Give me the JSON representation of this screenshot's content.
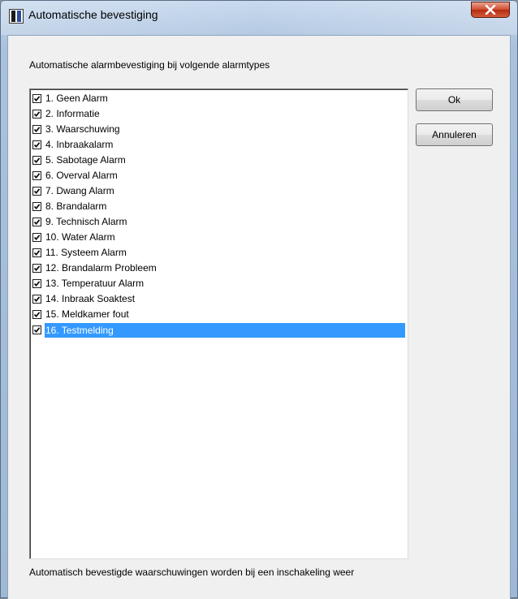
{
  "window": {
    "title": "Automatische bevestiging"
  },
  "labels": {
    "top": "Automatische alarmbevestiging bij volgende alarmtypes",
    "bottom": "Automatisch bevestigde waarschuwingen worden bij een inschakeling weer"
  },
  "buttons": {
    "ok": "Ok",
    "cancel": "Annuleren"
  },
  "alarm_types": [
    {
      "label": "1. Geen Alarm",
      "checked": true
    },
    {
      "label": "2. Informatie",
      "checked": true
    },
    {
      "label": "3. Waarschuwing",
      "checked": true
    },
    {
      "label": "4. Inbraakalarm",
      "checked": true
    },
    {
      "label": "5. Sabotage Alarm",
      "checked": true
    },
    {
      "label": "6. Overval Alarm",
      "checked": true
    },
    {
      "label": "7. Dwang Alarm",
      "checked": true
    },
    {
      "label": "8. Brandalarm",
      "checked": true
    },
    {
      "label": "9. Technisch Alarm",
      "checked": true
    },
    {
      "label": "10. Water Alarm",
      "checked": true
    },
    {
      "label": "11. Systeem Alarm",
      "checked": true
    },
    {
      "label": "12. Brandalarm Probleem",
      "checked": true
    },
    {
      "label": "13. Temperatuur Alarm",
      "checked": true
    },
    {
      "label": "14. Inbraak Soaktest",
      "checked": true
    },
    {
      "label": "15. Meldkamer fout",
      "checked": true
    },
    {
      "label": "16. Testmelding",
      "checked": true,
      "selected": true
    }
  ],
  "colors": {
    "selection": "#3399ff",
    "close_button": "#c7432b"
  },
  "icons": {
    "app": "app-icon",
    "close": "close-icon",
    "checkbox": "checkmark-icon"
  }
}
